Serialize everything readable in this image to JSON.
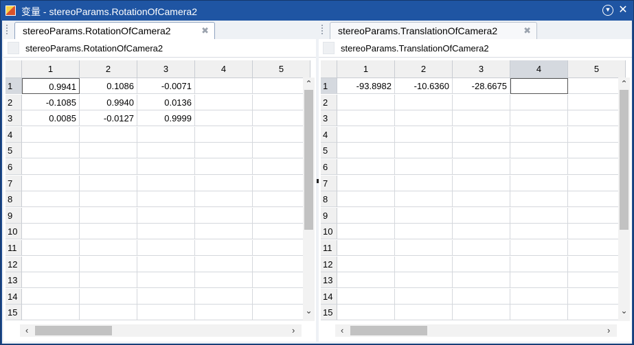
{
  "window": {
    "title": "变量 - stereoParams.RotationOfCamera2",
    "menu_icon": "chevron-down-circle-icon",
    "close_icon": "close-icon"
  },
  "left": {
    "tab_label": "stereoParams.RotationOfCamera2",
    "var_label": "stereoParams.RotationOfCamera2",
    "columns": [
      "1",
      "2",
      "3",
      "4",
      "5"
    ],
    "rows": [
      "1",
      "2",
      "3",
      "4",
      "5",
      "6",
      "7",
      "8",
      "9",
      "10",
      "11",
      "12",
      "13",
      "14",
      "15"
    ],
    "cells": [
      [
        "0.9941",
        "0.1086",
        "-0.0071"
      ],
      [
        "-0.1085",
        "0.9940",
        "0.0136"
      ],
      [
        "0.0085",
        "-0.0127",
        "0.9999"
      ]
    ]
  },
  "right": {
    "tab_label": "stereoParams.TranslationOfCamera2",
    "var_label": "stereoParams.TranslationOfCamera2",
    "columns": [
      "1",
      "2",
      "3",
      "4",
      "5"
    ],
    "rows": [
      "1",
      "2",
      "3",
      "4",
      "5",
      "6",
      "7",
      "8",
      "9",
      "10",
      "11",
      "12",
      "13",
      "14",
      "15"
    ],
    "cells": [
      [
        "-93.8982",
        "-10.6360",
        "-28.6675"
      ]
    ]
  },
  "glyphs": {
    "tab_close": "✖",
    "arrow_up": "⌃",
    "arrow_down": "⌄",
    "arrow_left": "‹",
    "arrow_right": "›",
    "menu": "▼",
    "close": "✕"
  }
}
